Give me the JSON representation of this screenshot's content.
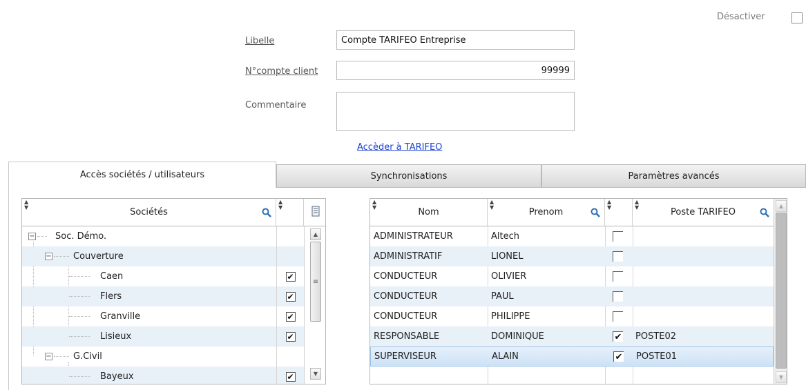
{
  "header": {
    "deactivate_label": "Désactiver"
  },
  "form": {
    "libelle_label": "Libelle",
    "libelle_value": "Compte TARIFEO Entreprise",
    "compte_label": "N°compte client",
    "compte_value": "99999",
    "commentaire_label": "Commentaire",
    "commentaire_value": "",
    "access_link": "Accèder à TARIFEO"
  },
  "tabs": [
    {
      "label": "Accès sociétés / utilisateurs",
      "active": true
    },
    {
      "label": "Synchronisations",
      "active": false
    },
    {
      "label": "Paramètres avancés",
      "active": false
    }
  ],
  "societes": {
    "header": "Sociétés",
    "rows": [
      {
        "label": "Soc. Démo.",
        "level": 0,
        "toggle": "−",
        "checked": null
      },
      {
        "label": "Couverture",
        "level": 1,
        "toggle": "−",
        "checked": null
      },
      {
        "label": "Caen",
        "level": 2,
        "toggle": null,
        "checked": true
      },
      {
        "label": "Flers",
        "level": 2,
        "toggle": null,
        "checked": true
      },
      {
        "label": "Granville",
        "level": 2,
        "toggle": null,
        "checked": true
      },
      {
        "label": "Lisieux",
        "level": 2,
        "toggle": null,
        "checked": true
      },
      {
        "label": "G.Civil",
        "level": 1,
        "toggle": "−",
        "checked": null
      },
      {
        "label": "Bayeux",
        "level": 2,
        "toggle": null,
        "checked": true
      }
    ]
  },
  "users": {
    "headers": {
      "nom": "Nom",
      "prenom": "Prenom",
      "poste": "Poste TARIFEO"
    },
    "rows": [
      {
        "nom": "ADMINISTRATEUR",
        "prenom": "Altech",
        "checked": false,
        "poste": ""
      },
      {
        "nom": "ADMINISTRATIF",
        "prenom": "LIONEL",
        "checked": false,
        "poste": ""
      },
      {
        "nom": "CONDUCTEUR",
        "prenom": "OLIVIER",
        "checked": false,
        "poste": ""
      },
      {
        "nom": "CONDUCTEUR",
        "prenom": "PAUL",
        "checked": false,
        "poste": ""
      },
      {
        "nom": "CONDUCTEUR",
        "prenom": "PHILIPPE",
        "checked": false,
        "poste": ""
      },
      {
        "nom": "RESPONSABLE",
        "prenom": "DOMINIQUE",
        "checked": true,
        "poste": "POSTE02"
      },
      {
        "nom": "SUPERVISEUR",
        "prenom": "ALAIN",
        "checked": true,
        "poste": "POSTE01",
        "selected": true
      }
    ]
  },
  "icons": {
    "search": "magnifier-icon",
    "sort": "sort-arrows-icon",
    "column_menu": "column-menu-icon"
  },
  "colors": {
    "link": "#1a3fd0",
    "alt_row": "#e8f0f8",
    "selected_row": "#cde2f6",
    "search_icon": "#2f6fb4"
  }
}
